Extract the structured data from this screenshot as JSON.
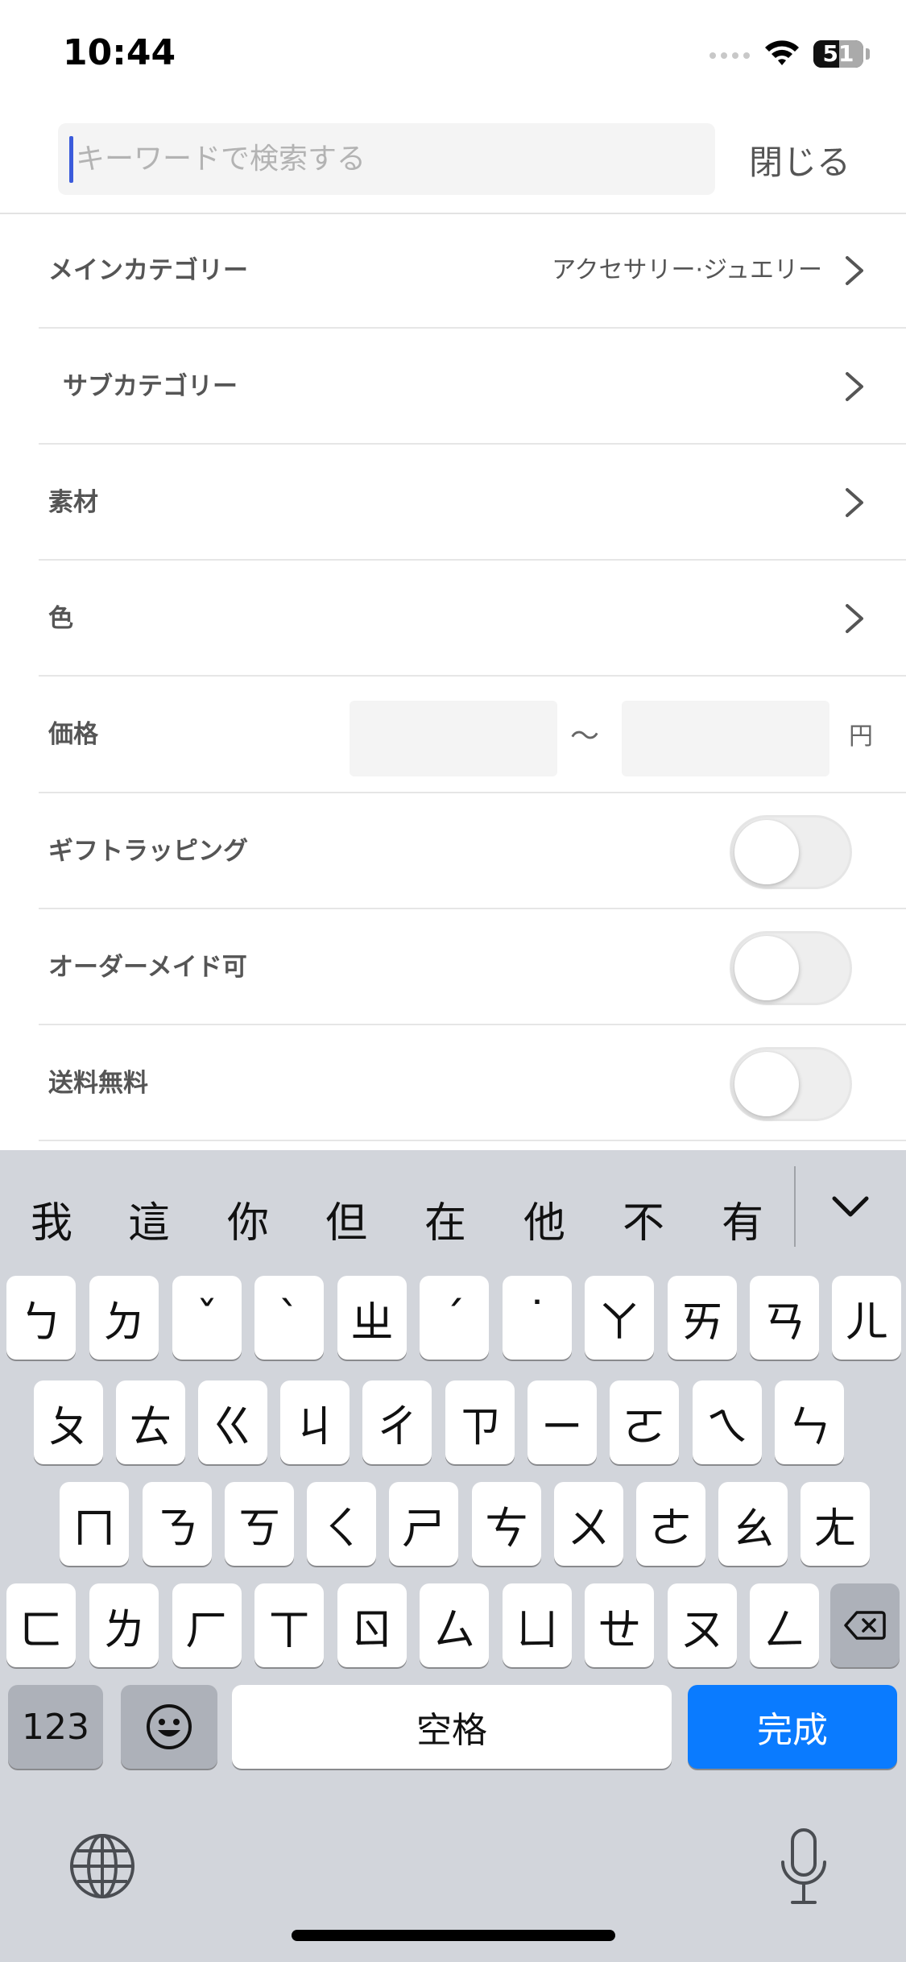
{
  "status_bar": {
    "time": "10:44",
    "battery": "51",
    "battery_level": 0.51
  },
  "search": {
    "placeholder": "キーワードで検索する",
    "value": "",
    "close_label": "閉じる"
  },
  "filters": {
    "main_category": {
      "label": "メインカテゴリー",
      "value": "アクセサリー·ジュエリー"
    },
    "sub_category": {
      "label": "サブカテゴリー",
      "value": ""
    },
    "material": {
      "label": "素材"
    },
    "color": {
      "label": "色"
    },
    "price": {
      "label": "価格",
      "min": "",
      "max": "",
      "separator": "〜",
      "unit": "円"
    },
    "gift_wrapping": {
      "label": "ギフトラッピング",
      "on": false
    },
    "custom_order": {
      "label": "オーダーメイド可",
      "on": false
    },
    "free_shipping": {
      "label": "送料無料",
      "on": false
    }
  },
  "keyboard": {
    "candidates": [
      "我",
      "這",
      "你",
      "但",
      "在",
      "他",
      "不",
      "有"
    ],
    "row1": [
      "ㄅ",
      "ㄉ",
      "ˇ",
      "ˋ",
      "ㄓ",
      "ˊ",
      "˙",
      "ㄚ",
      "ㄞ",
      "ㄢ",
      "ㄦ"
    ],
    "row2": [
      "ㄆ",
      "ㄊ",
      "ㄍ",
      "ㄐ",
      "ㄔ",
      "ㄗ",
      "ㄧ",
      "ㄛ",
      "ㄟ",
      "ㄣ"
    ],
    "row3": [
      "ㄇ",
      "ㄋ",
      "ㄎ",
      "ㄑ",
      "ㄕ",
      "ㄘ",
      "ㄨ",
      "ㄜ",
      "ㄠ",
      "ㄤ"
    ],
    "row4": [
      "ㄈ",
      "ㄌ",
      "ㄏ",
      "ㄒ",
      "ㄖ",
      "ㄙ",
      "ㄩ",
      "ㄝ",
      "ㄡ",
      "ㄥ"
    ],
    "numbers_label": "123",
    "space_label": "空格",
    "done_label": "完成"
  },
  "colors": {
    "accent_blue": "#0a7bff",
    "caret": "#3b5bdb",
    "keyboard_bg": "#d2d5db"
  },
  "icons": [
    "wifi-icon",
    "cellular-signal-icon",
    "battery-icon",
    "chevron-right-icon",
    "chevron-down-icon",
    "backspace-icon",
    "emoji-icon",
    "globe-icon",
    "microphone-icon"
  ]
}
